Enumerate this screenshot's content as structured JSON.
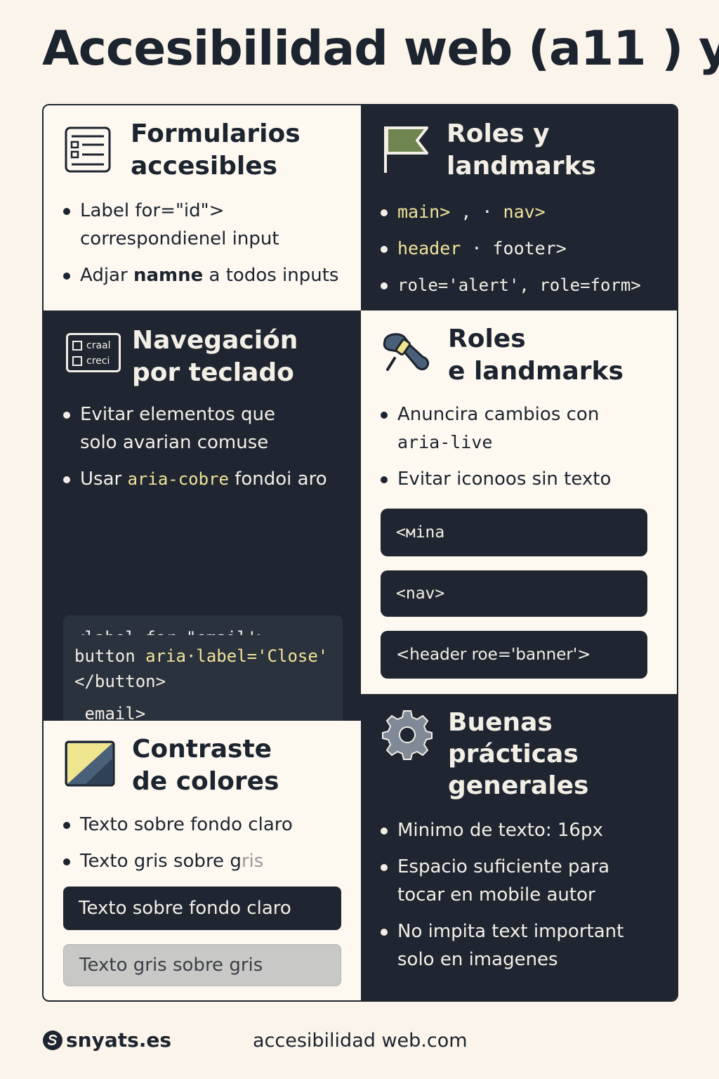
{
  "title": "Accesibilidad web (a11 ) y",
  "panels": {
    "forms": {
      "title_line1": "Formularios",
      "title_line2": "accesibles",
      "icon": "form-list-icon",
      "b1_line1": "Label for=\"id\">",
      "b1_line2": "correspondienel input",
      "b2_pre": "Adjar ",
      "b2_bold": "namne",
      "b2_post": " a todos inputs"
    },
    "roles": {
      "title_line1": "Roles y",
      "title_line2": "landmarks",
      "icon": "flag-icon",
      "b1_a": "main>",
      "b1_sep": " , · ",
      "b1_b": "nav>",
      "b2_a": "header",
      "b2_sep": " · ",
      "b2_b": "footer>",
      "b3": "role='alert', role=form>"
    },
    "keyboard": {
      "title_line1": "Navegación",
      "title_line2": "por teclado",
      "icon": "keyboard-keys-icon",
      "icon_key1": "craal",
      "icon_key2": "creci",
      "b1_line1": "Evitar elementos que",
      "b1_line2": "solo avarian comuse",
      "b2_pre": "Usar ",
      "b2_hl": "aria-cobre",
      "b2_post": " fondoi aro",
      "code1": "<label for=\"email'>\n <Email·/label>\n<input id=\"email\"  type=\n email>",
      "code2_a": "button ",
      "code2_hl": "aria·label='Close'",
      "code2_b": "</button>"
    },
    "aria": {
      "title_line1": "Roles",
      "title_line2": "e landmarks",
      "icon": "tools-icon",
      "b1_line1": "Anuncira cambios con",
      "b1_line2": "aria-live",
      "b2": "Evitar iconoos sin texto",
      "pills": [
        "<мina",
        "<nav>",
        "<header roe='banner'>"
      ]
    },
    "contrast": {
      "title_line1": "Contraste",
      "title_line2": "de colores",
      "icon": "contrast-swatch-icon",
      "b1": "Texto sobre fondo claro",
      "b2_pre": "Texto gris sobre g",
      "b2_faded": "ris",
      "demo1": "Texto sobre fondo claro",
      "demo2": "Texto gris sobre gris"
    },
    "practices": {
      "title_line1": "Buenas",
      "title_line2": "prácticas",
      "title_line3": "generales",
      "icon": "gear-icon",
      "b1": "Minimo de texto: 16px",
      "b2_line1": "Espacio suficiente para",
      "b2_line2": "tocar en mobile autor",
      "b3_line1": "No impita text important",
      "b3_line2": "solo en imagenes"
    }
  },
  "footer": {
    "brand": "snyats.es",
    "url": "accesibilidad web.com"
  },
  "colors": {
    "background": "#fbf4ea",
    "dark": "#1f2631",
    "accent_yellow": "#f2e39a"
  }
}
